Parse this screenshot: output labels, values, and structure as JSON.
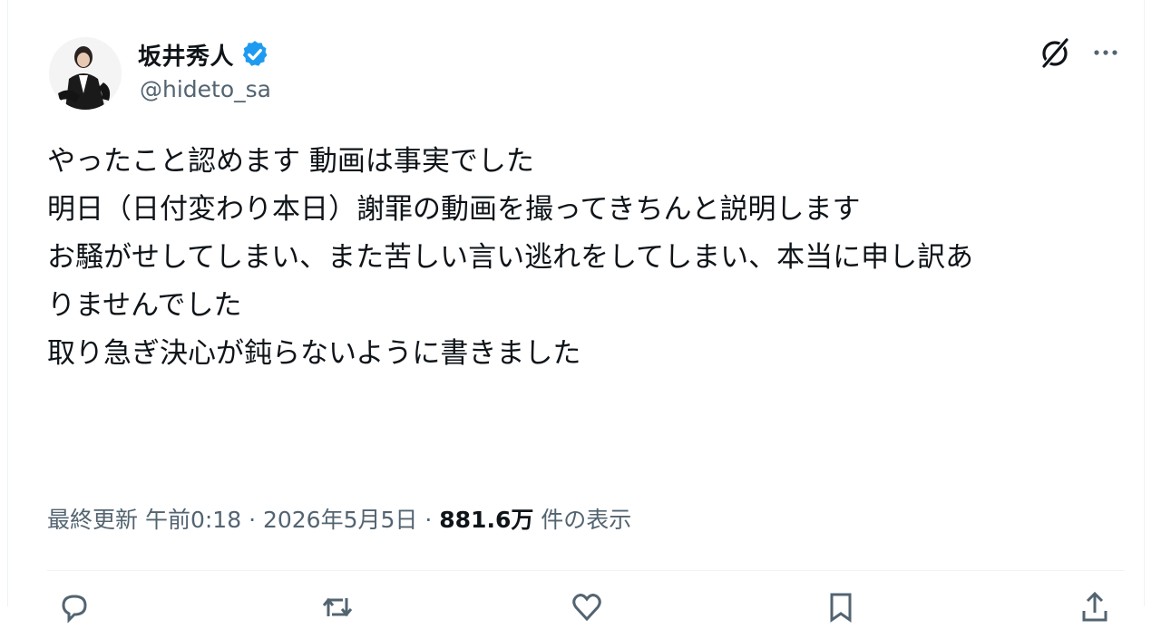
{
  "author": {
    "display_name": "坂井秀人",
    "handle": "@hideto_sa",
    "verified": true
  },
  "tweet": {
    "lines": [
      "やったこと認めます 動画は事実でした",
      "",
      "明日（日付変わり本日）謝罪の動画を撮ってきちんと説明します",
      "お騒がせしてしまい、また苦しい言い逃れをしてしまい、本当に申し訳あ",
      "りませんでした",
      "",
      "取り急ぎ決心が鈍らないように書きました"
    ]
  },
  "meta": {
    "updated_label": "最終更新",
    "time": "午前0:18",
    "separator": "·",
    "date": "2026年5月5日",
    "views_count": "881.6万",
    "views_label": "件の表示"
  },
  "icons": {
    "verified": "verified-badge-icon",
    "grok": "grok-icon",
    "more": "more-icon",
    "reply": "reply-icon",
    "retweet": "retweet-icon",
    "like": "like-icon",
    "bookmark": "bookmark-icon",
    "share": "share-icon"
  },
  "colors": {
    "text_primary": "#0f1419",
    "text_secondary": "#536471",
    "verified_blue": "#1d9bf0",
    "divider": "#eff3f4"
  }
}
